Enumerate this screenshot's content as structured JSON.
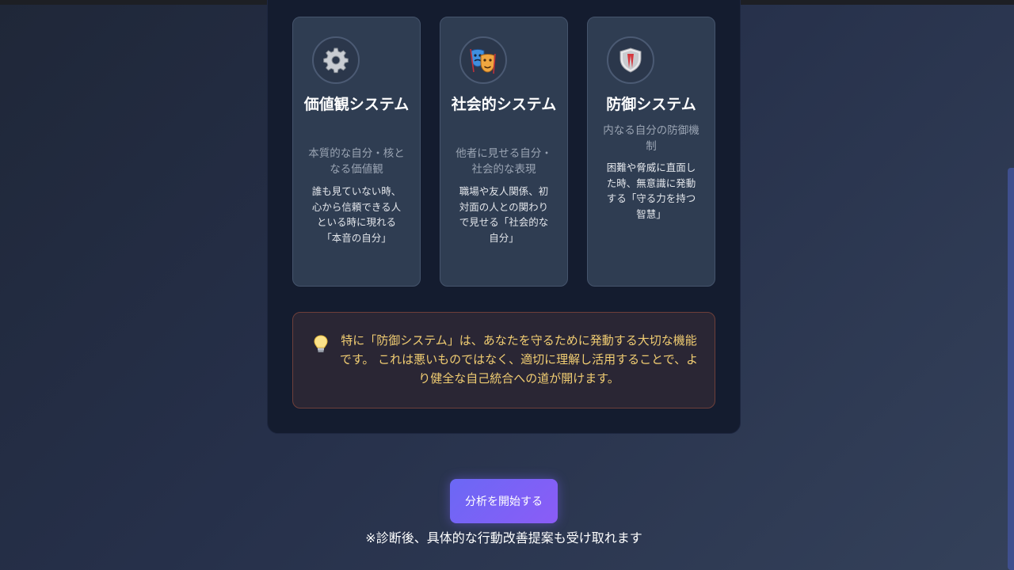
{
  "cards": [
    {
      "icon": "gear-icon",
      "title": "価値観システム",
      "subtitle": "本質的な自分・核となる価値観",
      "description": "誰も見ていない時、心から信頼できる人といる時に現れる「本音の自分」"
    },
    {
      "icon": "theater-masks-icon",
      "title": "社会的システム",
      "subtitle": "他者に見せる自分・社会的な表現",
      "description": "職場や友人関係、初対面の人との関わりで見せる「社会的な自分」"
    },
    {
      "icon": "shield-icon",
      "title": "防御システム",
      "subtitle": "内なる自分の防御機制",
      "description": "困難や脅威に直面した時、無意識に発動する「守る力を持つ智慧」"
    }
  ],
  "tip": {
    "icon": "lightbulb-icon",
    "text": "特に「防御システム」は、あなたを守るために発動する大切な機能です。 これは悪いものではなく、適切に理解し活用することで、より健全な自己統合への道が開けます。"
  },
  "start_button": {
    "label": "分析を開始する"
  },
  "note": "※診断後、具体的な行動改善提案も受け取れます",
  "colors": {
    "accent_start": "#6b68f5",
    "accent_end": "#8b5cf6",
    "tip_text": "#f1cd72",
    "card_bg": "#2f3d52",
    "panel_bg": "#141c2f"
  }
}
